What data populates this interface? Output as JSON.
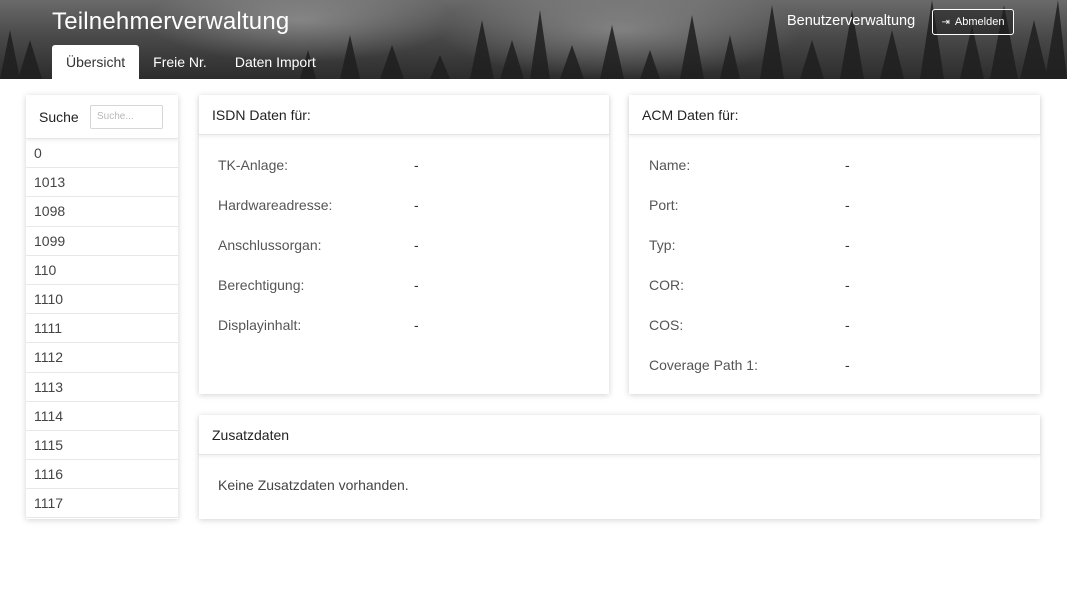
{
  "header": {
    "title": "Teilnehmerverwaltung",
    "user_management": "Benutzerverwaltung",
    "logout_label": "Abmelden",
    "logout_icon": "sign-out-icon"
  },
  "tabs": [
    {
      "label": "Übersicht",
      "active": true
    },
    {
      "label": "Freie Nr.",
      "active": false
    },
    {
      "label": "Daten Import",
      "active": false
    }
  ],
  "sidebar": {
    "search_label": "Suche",
    "search_placeholder": "Suche...",
    "search_value": "",
    "numbers": [
      "0",
      "1013",
      "1098",
      "1099",
      "110",
      "1110",
      "1111",
      "1112",
      "1113",
      "1114",
      "1115",
      "1116",
      "1117"
    ]
  },
  "isdn": {
    "title": "ISDN Daten für:",
    "fields": [
      {
        "label": "TK-Anlage:",
        "value": "-"
      },
      {
        "label": "Hardwareadresse:",
        "value": "-"
      },
      {
        "label": "Anschlussorgan:",
        "value": "-"
      },
      {
        "label": "Berechtigung:",
        "value": "-"
      },
      {
        "label": "Displayinhalt:",
        "value": "-"
      }
    ]
  },
  "acm": {
    "title": "ACM Daten für:",
    "fields": [
      {
        "label": "Name:",
        "value": "-"
      },
      {
        "label": "Port:",
        "value": "-"
      },
      {
        "label": "Typ:",
        "value": "-"
      },
      {
        "label": "COR:",
        "value": "-"
      },
      {
        "label": "COS:",
        "value": "-"
      },
      {
        "label": "Coverage Path 1:",
        "value": "-"
      }
    ]
  },
  "extra": {
    "title": "Zusatzdaten",
    "message": "Keine Zusatzdaten vorhanden."
  }
}
